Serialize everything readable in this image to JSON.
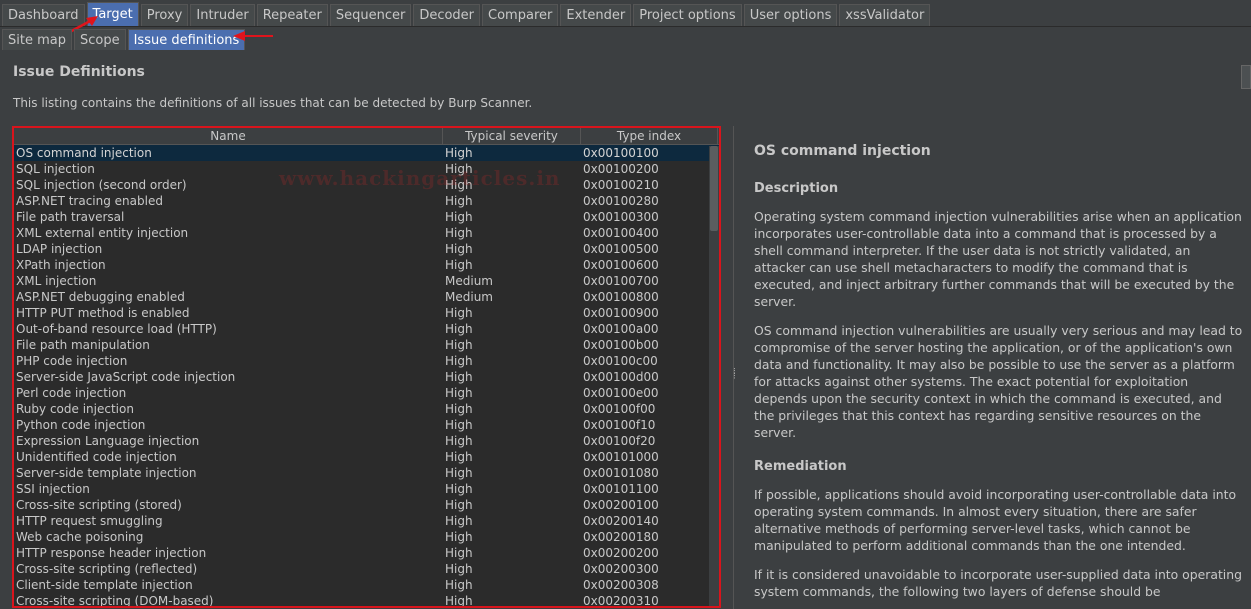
{
  "main_tabs": [
    "Dashboard",
    "Target",
    "Proxy",
    "Intruder",
    "Repeater",
    "Sequencer",
    "Decoder",
    "Comparer",
    "Extender",
    "Project options",
    "User options",
    "xssValidator"
  ],
  "main_active": "Target",
  "sub_tabs": [
    "Site map",
    "Scope",
    "Issue definitions"
  ],
  "sub_active": "Issue definitions",
  "page": {
    "title": "Issue Definitions",
    "description": "This listing contains the definitions of all issues that can be detected by Burp Scanner."
  },
  "table": {
    "headers": [
      "Name",
      "Typical severity",
      "Type index"
    ],
    "selected_index": 0,
    "rows": [
      [
        "OS command injection",
        "High",
        "0x00100100"
      ],
      [
        "SQL injection",
        "High",
        "0x00100200"
      ],
      [
        "SQL injection (second order)",
        "High",
        "0x00100210"
      ],
      [
        "ASP.NET tracing enabled",
        "High",
        "0x00100280"
      ],
      [
        "File path traversal",
        "High",
        "0x00100300"
      ],
      [
        "XML external entity injection",
        "High",
        "0x00100400"
      ],
      [
        "LDAP injection",
        "High",
        "0x00100500"
      ],
      [
        "XPath injection",
        "High",
        "0x00100600"
      ],
      [
        "XML injection",
        "Medium",
        "0x00100700"
      ],
      [
        "ASP.NET debugging enabled",
        "Medium",
        "0x00100800"
      ],
      [
        "HTTP PUT method is enabled",
        "High",
        "0x00100900"
      ],
      [
        "Out-of-band resource load (HTTP)",
        "High",
        "0x00100a00"
      ],
      [
        "File path manipulation",
        "High",
        "0x00100b00"
      ],
      [
        "PHP code injection",
        "High",
        "0x00100c00"
      ],
      [
        "Server-side JavaScript code injection",
        "High",
        "0x00100d00"
      ],
      [
        "Perl code injection",
        "High",
        "0x00100e00"
      ],
      [
        "Ruby code injection",
        "High",
        "0x00100f00"
      ],
      [
        "Python code injection",
        "High",
        "0x00100f10"
      ],
      [
        "Expression Language injection",
        "High",
        "0x00100f20"
      ],
      [
        "Unidentified code injection",
        "High",
        "0x00101000"
      ],
      [
        "Server-side template injection",
        "High",
        "0x00101080"
      ],
      [
        "SSI injection",
        "High",
        "0x00101100"
      ],
      [
        "Cross-site scripting (stored)",
        "High",
        "0x00200100"
      ],
      [
        "HTTP request smuggling",
        "High",
        "0x00200140"
      ],
      [
        "Web cache poisoning",
        "High",
        "0x00200180"
      ],
      [
        "HTTP response header injection",
        "High",
        "0x00200200"
      ],
      [
        "Cross-site scripting (reflected)",
        "High",
        "0x00200300"
      ],
      [
        "Client-side template injection",
        "High",
        "0x00200308"
      ],
      [
        "Cross-site scripting (DOM-based)",
        "High",
        "0x00200310"
      ]
    ]
  },
  "watermark": "www.hackingarticles.in",
  "detail": {
    "title": "OS command injection",
    "description_heading": "Description",
    "description_p1": "Operating system command injection vulnerabilities arise when an application incorporates user-controllable data into a command that is processed by a shell command interpreter. If the user data is not strictly validated, an attacker can use shell metacharacters to modify the command that is executed, and inject arbitrary further commands that will be executed by the server.",
    "description_p2": "OS command injection vulnerabilities are usually very serious and may lead to compromise of the server hosting the application, or of the application's own data and functionality. It may also be possible to use the server as a platform for attacks against other systems. The exact potential for exploitation depends upon the security context in which the command is executed, and the privileges that this context has regarding sensitive resources on the server.",
    "remediation_heading": "Remediation",
    "remediation_p1": "If possible, applications should avoid incorporating user-controllable data into operating system commands. In almost every situation, there are safer alternative methods of performing server-level tasks, which cannot be manipulated to perform additional commands than the one intended.",
    "remediation_p2": "If it is considered unavoidable to incorporate user-supplied data into operating system commands, the following two layers of defense should be"
  },
  "colors": {
    "accent": "#4b6eaf",
    "highlight_border": "#d9141c",
    "selected_row": "#0d293e",
    "background": "#3c3f41"
  }
}
